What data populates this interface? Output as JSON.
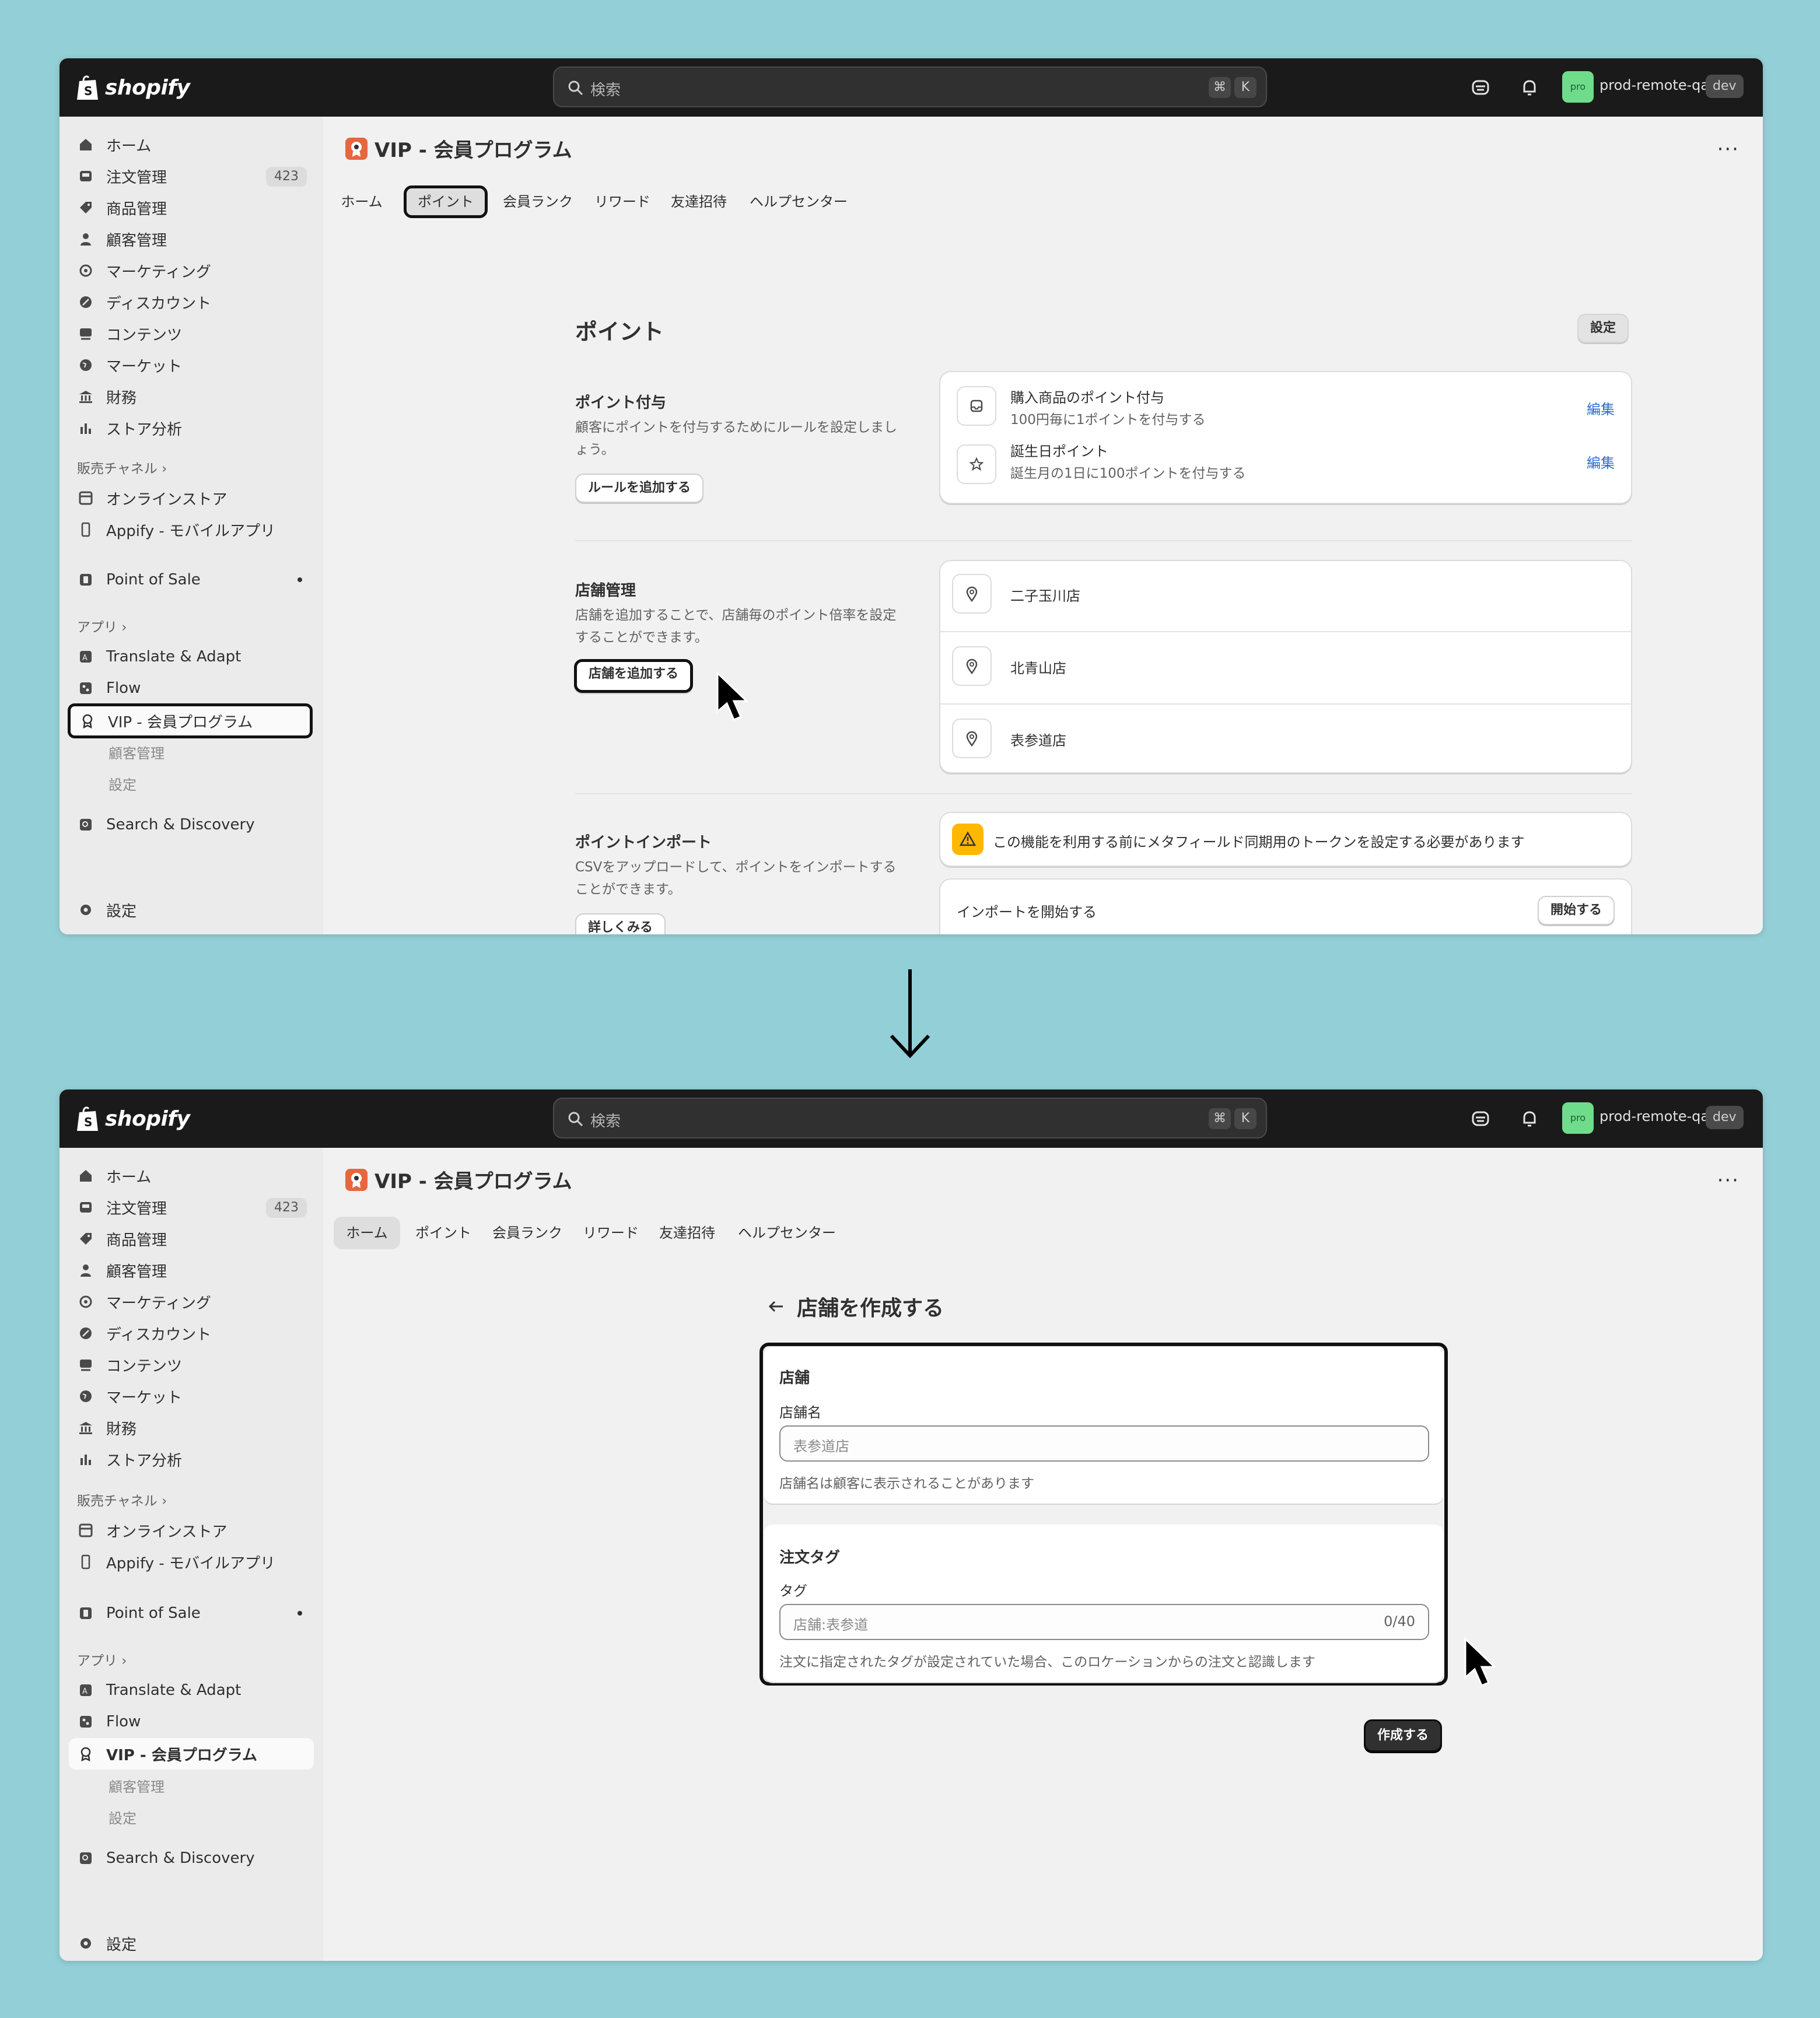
{
  "topbar": {
    "logo_text": "shopify",
    "search_placeholder": "検索",
    "kbd_cmd": "⌘",
    "kbd_k": "K",
    "avatar_text": "pro",
    "store_name": "prod-remote-qa",
    "env_badge": "dev"
  },
  "sidebar": {
    "home": "ホーム",
    "orders": "注文管理",
    "orders_count": "423",
    "products": "商品管理",
    "customers": "顧客管理",
    "marketing": "マーケティング",
    "discounts": "ディスカウント",
    "content": "コンテンツ",
    "markets": "マーケット",
    "finance": "財務",
    "analytics": "ストア分析",
    "sales_channels": "販売チャネル ›",
    "online_store": "オンラインストア",
    "appify": "Appify - モバイルアプリ",
    "pos": "Point of Sale",
    "apps": "アプリ ›",
    "translate": "Translate & Adapt",
    "flow": "Flow",
    "vip": "VIP - 会員プログラム",
    "vip_customers": "顧客管理",
    "vip_settings": "設定",
    "search_discovery": "Search & Discovery",
    "settings": "設定"
  },
  "page": {
    "title": "VIP - 会員プログラム",
    "more": "···",
    "tabs": [
      "ホーム",
      "ポイント",
      "会員ランク",
      "リワード",
      "友達招待",
      "ヘルプセンター"
    ]
  },
  "points_screen": {
    "heading": "ポイント",
    "settings_button": "設定",
    "grant": {
      "title": "ポイント付与",
      "desc": "顧客にポイントを付与するためにルールを設定しましょう。",
      "button": "ルールを追加する",
      "rules": [
        {
          "title": "購入商品のポイント付与",
          "sub": "100円毎に1ポイントを付与する",
          "action": "編集",
          "icon": "package-icon"
        },
        {
          "title": "誕生日ポイント",
          "sub": "誕生月の1日に100ポイントを付与する",
          "action": "編集",
          "icon": "star-icon"
        }
      ]
    },
    "stores": {
      "title": "店舗管理",
      "desc": "店舗を追加することで、店舗毎のポイント倍率を設定することができます。",
      "button": "店舗を追加する",
      "items": [
        "二子玉川店",
        "北青山店",
        "表参道店"
      ]
    },
    "import": {
      "title": "ポイントインポート",
      "desc": "CSVをアップロードして、ポイントをインポートすることができます。",
      "button": "詳しくみる",
      "warning": "この機能を利用する前にメタフィールド同期用のトークンを設定する必要があります",
      "start_label": "インポートを開始する",
      "start_button": "開始する"
    }
  },
  "create_screen": {
    "back_title": "店舗を作成する",
    "store_card": {
      "title": "店舗",
      "label": "店舗名",
      "placeholder": "表参道店",
      "help": "店舗名は顧客に表示されることがあります"
    },
    "tag_card": {
      "title": "注文タグ",
      "label": "タグ",
      "placeholder": "店舗:表参道",
      "counter": "0/40",
      "help": "注文に指定されたタグが設定されていた場合、このロケーションからの注文と認識します"
    },
    "create_button": "作成する"
  }
}
